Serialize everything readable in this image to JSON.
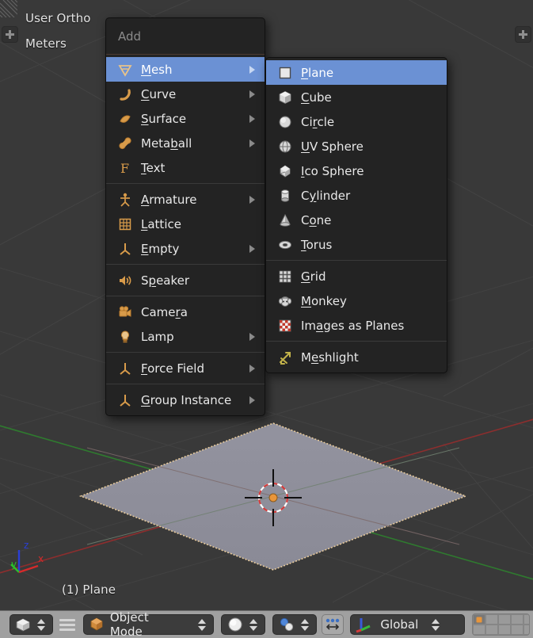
{
  "viewport": {
    "view_name": "User Ortho",
    "units": "Meters",
    "object_name": "(1) Plane",
    "background_color": "#393939",
    "plane_fill_color": "#8d8d9a",
    "plane_outline_color": "#e5c89a",
    "axis_gizmo": {
      "z_label": "z",
      "y_label": "y",
      "x_label": "x",
      "z_color": "#2a3fd6",
      "y_color": "#2ac12a",
      "x_color": "#d62a2a"
    },
    "cursor_dot_color": "#e8953a",
    "toggle_left_icon": "plus-icon",
    "toggle_right_icon": "plus-icon"
  },
  "add_menu": {
    "title": "Add",
    "highlight_color": "#6b91d4",
    "items": [
      {
        "label": "Mesh",
        "accel": "M",
        "icon": "mesh-icon",
        "has_submenu": true,
        "selected": true,
        "separator_before": false
      },
      {
        "label": "Curve",
        "accel": "C",
        "icon": "curve-icon",
        "has_submenu": true,
        "selected": false,
        "separator_before": false
      },
      {
        "label": "Surface",
        "accel": "S",
        "icon": "surface-icon",
        "has_submenu": true,
        "selected": false,
        "separator_before": false
      },
      {
        "label": "Metaball",
        "accel": "b",
        "icon": "metaball-icon",
        "has_submenu": true,
        "selected": false,
        "separator_before": false
      },
      {
        "label": "Text",
        "accel": "T",
        "icon": "text-icon",
        "has_submenu": false,
        "selected": false,
        "separator_before": false
      },
      {
        "label": "Armature",
        "accel": "A",
        "icon": "armature-icon",
        "has_submenu": true,
        "selected": false,
        "separator_before": true
      },
      {
        "label": "Lattice",
        "accel": "L",
        "icon": "lattice-icon",
        "has_submenu": false,
        "selected": false,
        "separator_before": false
      },
      {
        "label": "Empty",
        "accel": "E",
        "icon": "empty-icon",
        "has_submenu": true,
        "selected": false,
        "separator_before": false
      },
      {
        "label": "Speaker",
        "accel": "p",
        "icon": "speaker-icon",
        "has_submenu": false,
        "selected": false,
        "separator_before": true
      },
      {
        "label": "Camera",
        "accel": "r",
        "icon": "camera-icon",
        "has_submenu": false,
        "selected": false,
        "separator_before": true
      },
      {
        "label": "Lamp",
        "accel": "",
        "icon": "lamp-icon",
        "has_submenu": true,
        "selected": false,
        "separator_before": false
      },
      {
        "label": "Force Field",
        "accel": "F",
        "icon": "forcefield-icon",
        "has_submenu": true,
        "selected": false,
        "separator_before": true
      },
      {
        "label": "Group Instance",
        "accel": "G",
        "icon": "group-icon",
        "has_submenu": true,
        "selected": false,
        "separator_before": true
      }
    ]
  },
  "mesh_submenu": {
    "items": [
      {
        "label": "Plane",
        "accel": "P",
        "icon": "plane-icon",
        "selected": true,
        "separator_before": false
      },
      {
        "label": "Cube",
        "accel": "C",
        "icon": "cube-icon",
        "selected": false,
        "separator_before": false
      },
      {
        "label": "Circle",
        "accel": "r",
        "icon": "circle-icon",
        "selected": false,
        "separator_before": false
      },
      {
        "label": "UV Sphere",
        "accel": "U",
        "icon": "uvsphere-icon",
        "selected": false,
        "separator_before": false
      },
      {
        "label": "Ico Sphere",
        "accel": "I",
        "icon": "icosphere-icon",
        "selected": false,
        "separator_before": false
      },
      {
        "label": "Cylinder",
        "accel": "y",
        "icon": "cylinder-icon",
        "selected": false,
        "separator_before": false
      },
      {
        "label": "Cone",
        "accel": "o",
        "icon": "cone-icon",
        "selected": false,
        "separator_before": false
      },
      {
        "label": "Torus",
        "accel": "T",
        "icon": "torus-icon",
        "selected": false,
        "separator_before": false
      },
      {
        "label": "Grid",
        "accel": "G",
        "icon": "grid-icon",
        "selected": false,
        "separator_before": true
      },
      {
        "label": "Monkey",
        "accel": "M",
        "icon": "monkey-icon",
        "selected": false,
        "separator_before": false
      },
      {
        "label": "Images as Planes",
        "accel": "a",
        "icon": "images-icon",
        "selected": false,
        "separator_before": false
      },
      {
        "label": "Meshlight",
        "accel": "e",
        "icon": "meshlight-icon",
        "selected": false,
        "separator_before": true
      }
    ]
  },
  "header": {
    "editor_type_icon": "editor-3dview-icon",
    "menu_icon": "hamburger-icon",
    "mode_label": "Object Mode",
    "mode_icon": "object-mode-cube-icon",
    "shading_icon": "shading-solid-icon",
    "pivot_icon": "pivot-median-icon",
    "snap_icon": "snap-magnet-icon",
    "orientation_label": "Global",
    "orientation_icon": "axis-gizmo-icon",
    "layers": {
      "rows": 2,
      "cols": 5,
      "active_index": 0,
      "active_color": "#e8953a"
    }
  }
}
